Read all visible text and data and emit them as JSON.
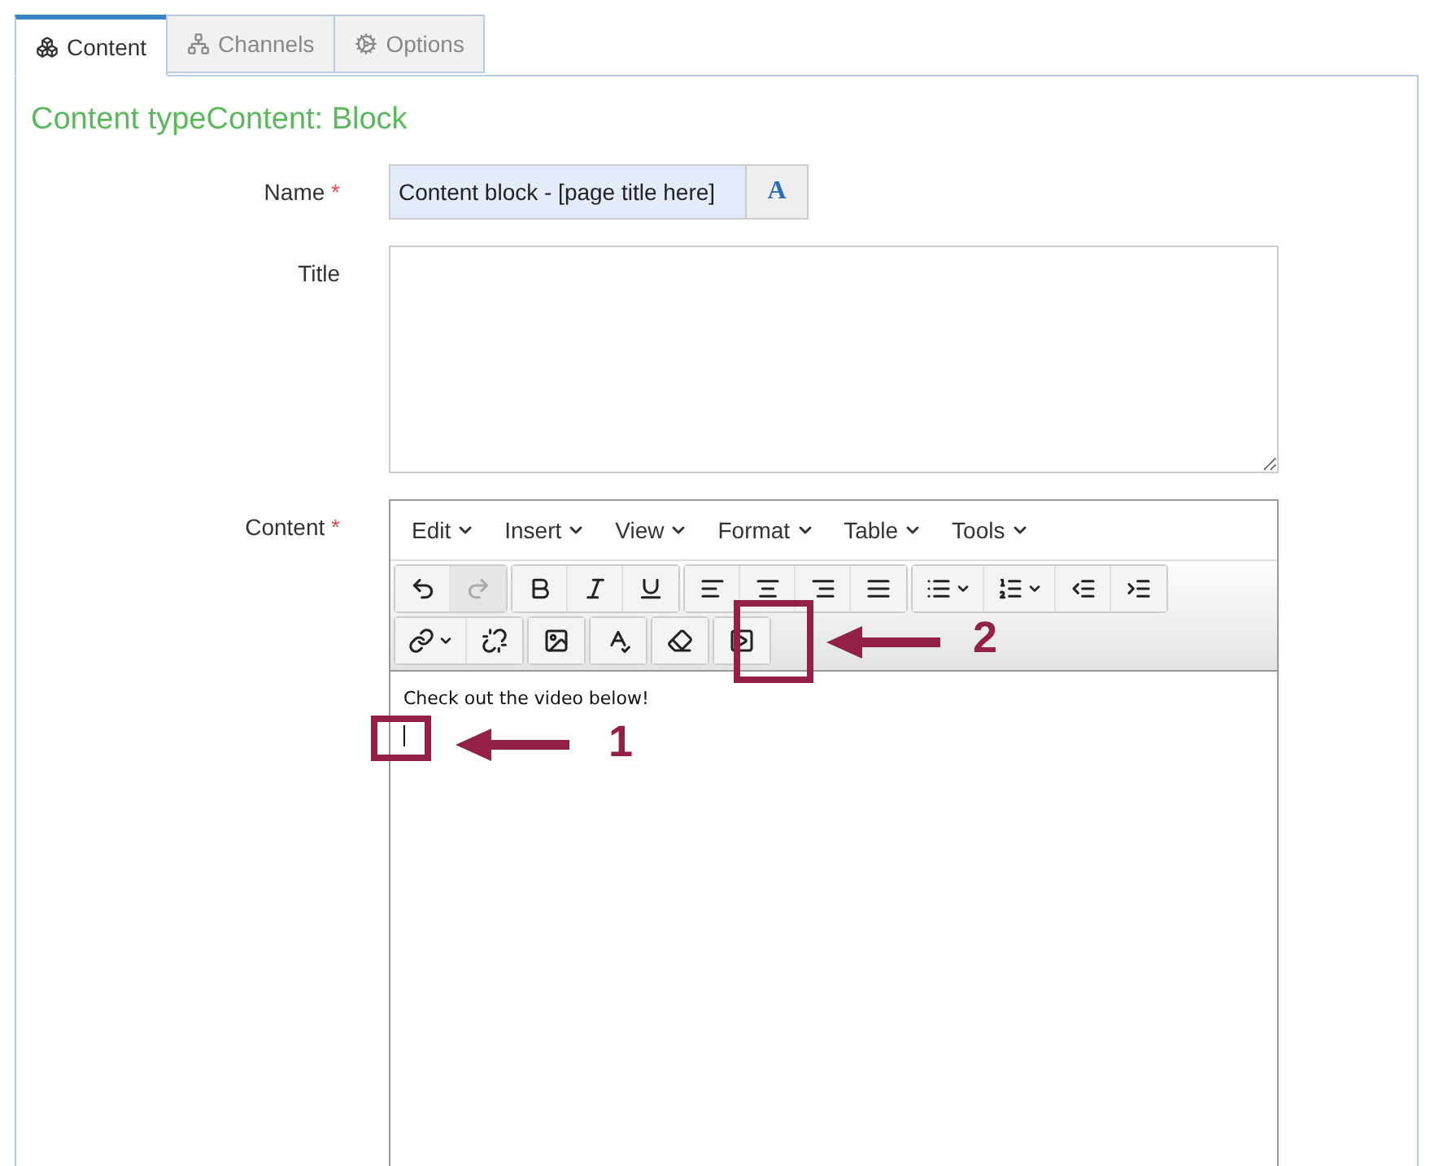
{
  "tabs": [
    {
      "label": "Content",
      "selected": true
    },
    {
      "label": "Channels",
      "selected": false
    },
    {
      "label": "Options",
      "selected": false
    }
  ],
  "heading": "Content typeContent: Block",
  "fields": [
    {
      "kind": "name",
      "label": "Name",
      "required_mark": "*",
      "value": "Content block - [page title here]",
      "button": "A"
    },
    {
      "kind": "title",
      "label": "Title"
    },
    {
      "kind": "content",
      "label": "Content",
      "required_mark": "*"
    }
  ],
  "editor": {
    "menus": [
      {
        "label": "Edit"
      },
      {
        "label": "Insert"
      },
      {
        "label": "View"
      },
      {
        "label": "Format"
      },
      {
        "label": "Table"
      },
      {
        "label": "Tools"
      }
    ],
    "toolbar_rows": [
      [
        [
          {
            "kind": "undo",
            "disabled": false
          },
          {
            "kind": "redo",
            "disabled": true
          }
        ],
        [
          {
            "kind": "bold",
            "disabled": false
          },
          {
            "kind": "italic",
            "disabled": false
          },
          {
            "kind": "underline",
            "disabled": false
          }
        ],
        [
          {
            "kind": "align-left",
            "disabled": false
          },
          {
            "kind": "align-center",
            "disabled": false
          },
          {
            "kind": "align-right",
            "disabled": false
          },
          {
            "kind": "justify",
            "disabled": false
          }
        ],
        [
          {
            "kind": "bullet-list",
            "disabled": false,
            "dropdown": true
          },
          {
            "kind": "numbered-list",
            "disabled": false,
            "dropdown": true
          },
          {
            "kind": "outdent",
            "disabled": false
          },
          {
            "kind": "indent",
            "disabled": false
          }
        ]
      ],
      [
        [
          {
            "kind": "link",
            "disabled": false,
            "dropdown": true
          },
          {
            "kind": "unlink",
            "disabled": false
          }
        ],
        [
          {
            "kind": "image",
            "disabled": false
          }
        ],
        [
          {
            "kind": "spellcheck",
            "disabled": false
          }
        ],
        [
          {
            "kind": "eraser",
            "disabled": false
          }
        ],
        [
          {
            "kind": "video",
            "disabled": false
          }
        ]
      ]
    ],
    "text": "Check out the video below!"
  },
  "annotations": [
    {
      "number": "1"
    },
    {
      "number": "2"
    }
  ]
}
